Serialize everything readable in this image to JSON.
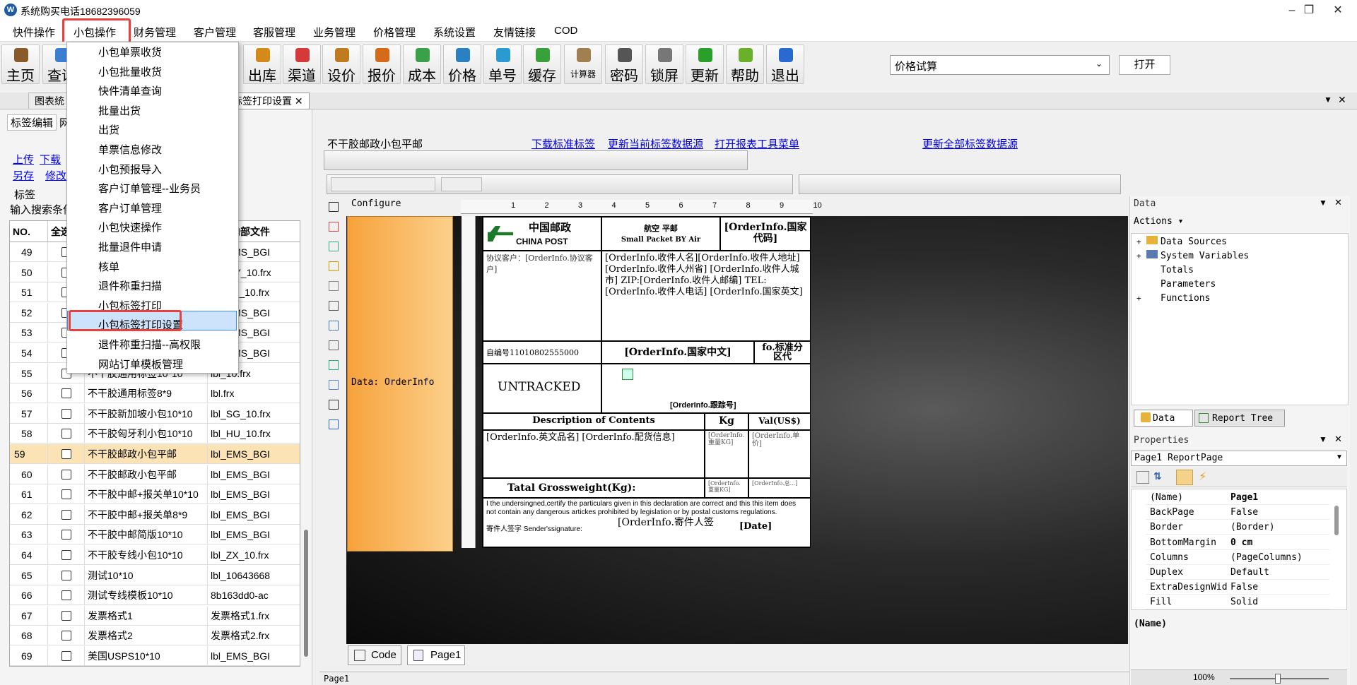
{
  "window": {
    "title": "系统购买电话18682396059",
    "icon": "app-logo-icon"
  },
  "menubar": [
    "快件操作",
    "小包操作",
    "财务管理",
    "客户管理",
    "客服管理",
    "业务管理",
    "价格管理",
    "系统设置",
    "友情链接",
    "COD"
  ],
  "toolbar": {
    "buttons": [
      {
        "label": "主页",
        "icon": "home-icon",
        "color": "#8a5a2b"
      },
      {
        "label": "查询",
        "icon": "search-icon",
        "color": "#3a7fd0"
      },
      {
        "label": "出库",
        "icon": "outbound-icon",
        "color": "#d48a1a"
      },
      {
        "label": "渠道",
        "icon": "channel-icon",
        "color": "#d43a3a"
      },
      {
        "label": "设价",
        "icon": "scale-icon",
        "color": "#c07a20"
      },
      {
        "label": "报价",
        "icon": "quote-icon",
        "color": "#d46a1a"
      },
      {
        "label": "成本",
        "icon": "chart-icon",
        "color": "#3aa04a"
      },
      {
        "label": "价格",
        "icon": "price-icon",
        "color": "#2a80c0"
      },
      {
        "label": "单号",
        "icon": "eye-icon",
        "color": "#2a9ad0"
      },
      {
        "label": "缓存",
        "icon": "refresh-icon",
        "color": "#3aa03a"
      },
      {
        "label": "计算器",
        "icon": "calculator-icon",
        "color": "#a08050"
      },
      {
        "label": "密码",
        "icon": "key-icon",
        "color": "#555"
      },
      {
        "label": "锁屏",
        "icon": "lock-icon",
        "color": "#777"
      },
      {
        "label": "更新",
        "icon": "download-icon",
        "color": "#2aa02a"
      },
      {
        "label": "帮助",
        "icon": "help-icon",
        "color": "#6ab02a"
      },
      {
        "label": "退出",
        "icon": "power-icon",
        "color": "#2a6ad0"
      }
    ],
    "combo_value": "价格试算",
    "open_label": "打开"
  },
  "tabs": [
    "图表统",
    "标签打印设置"
  ],
  "left": {
    "subtabs": [
      "标签编辑",
      "网"
    ],
    "links": [
      "上传",
      "下载",
      "另存",
      "修改"
    ],
    "group_label": "标签",
    "search_label": "输入搜索条件",
    "columns": [
      "NO.",
      "全选",
      "",
      "标签内部文件"
    ],
    "rows": [
      {
        "no": "49",
        "name": "",
        "file": "lbl_EMS_BGI"
      },
      {
        "no": "50",
        "name": "",
        "file": "lbl_MY_10.frx"
      },
      {
        "no": "51",
        "name": "",
        "file": "lbl_SE_10.frx"
      },
      {
        "no": "52",
        "name": "",
        "file": "lbl_EMS_BGI"
      },
      {
        "no": "53",
        "name": "",
        "file": "lbl_EMS_BGI"
      },
      {
        "no": "54",
        "name": "",
        "file": "lbl_EMS_BGI"
      },
      {
        "no": "55",
        "name": "不干胶通用标签10*10",
        "file": "lbl_10.frx"
      },
      {
        "no": "56",
        "name": "不干胶通用标签8*9",
        "file": "lbl.frx"
      },
      {
        "no": "57",
        "name": "不干胶新加坡小包10*10",
        "file": "lbl_SG_10.frx"
      },
      {
        "no": "58",
        "name": "不干胶匈牙利小包10*10",
        "file": "lbl_HU_10.frx"
      },
      {
        "no": "59",
        "name": "不干胶邮政小包平邮",
        "file": "lbl_EMS_BGI"
      },
      {
        "no": "60",
        "name": "不干胶邮政小包平邮",
        "file": "lbl_EMS_BGI"
      },
      {
        "no": "61",
        "name": "不干胶中邮+报关单10*10",
        "file": "lbl_EMS_BGI"
      },
      {
        "no": "62",
        "name": "不干胶中邮+报关单8*9",
        "file": "lbl_EMS_BGI"
      },
      {
        "no": "63",
        "name": "不干胶中邮简版10*10",
        "file": "lbl_EMS_BGI"
      },
      {
        "no": "64",
        "name": "不干胶专线小包10*10",
        "file": "lbl_ZX_10.frx"
      },
      {
        "no": "65",
        "name": "测试10*10",
        "file": "lbl_10643668"
      },
      {
        "no": "66",
        "name": "测试专线模板10*10",
        "file": "8b163dd0-ac"
      },
      {
        "no": "67",
        "name": "发票格式1",
        "file": "发票格式1.frx"
      },
      {
        "no": "68",
        "name": "发票格式2",
        "file": "发票格式2.frx"
      },
      {
        "no": "69",
        "name": "美国USPS10*10",
        "file": "lbl_EMS_BGI"
      }
    ],
    "selected_row": "59"
  },
  "dropdown": [
    "小包单票收货",
    "小包批量收货",
    "快件清单查询",
    "批量出货",
    "出货",
    "单票信息修改",
    "小包预报导入",
    "客户订单管理--业务员",
    "客户订单管理",
    "小包快速操作",
    "批量退件申请",
    "核单",
    "退件称重扫描",
    "小包标签打印",
    "小包标签打印设置",
    "退件称重扫描--高权限",
    "网站订单模板管理"
  ],
  "dropdown_selected": "小包标签打印设置",
  "designer": {
    "report_name": "不干胶邮政小包平邮",
    "links": [
      "下载标准标签",
      "更新当前标签数据源",
      "打开报表工具菜单",
      "更新全部标签数据源"
    ],
    "band_title": "Configure",
    "band_data": "Data: OrderInfo",
    "ruler": [
      "1",
      "2",
      "3",
      "4",
      "5",
      "6",
      "7",
      "8",
      "9",
      "10"
    ],
    "label": {
      "logo_cn": "中国邮政",
      "logo_en": "CHINA POST",
      "air_cn": "航空 平邮",
      "air_en": "Small Packet BY Air",
      "country_code": "[OrderInfo.国家代码]",
      "customer": "协议客户：[OrderInfo.协议客户]",
      "receiver": "[OrderInfo.收件人名][OrderInfo.收件人地址][OrderInfo.收件人州省] [OrderInfo.收件人城市] ZIP:[OrderInfo.收件人邮编] TEL:[OrderInfo.收件人电话] [OrderInfo.国家英文]",
      "pickup": "自编号11010802555000",
      "country_cn": "[OrderInfo.国家中文]",
      "zone": "fo.标准分区代",
      "untracked": "UNTRACKED",
      "tracking": "[OrderInfo.跟踪号]",
      "desc_header": "Description of Contents",
      "kg_header": "Kg",
      "val_header": "Val(US$)",
      "desc_value": "[OrderInfo.英文品名] [OrderInfo.配货信息]",
      "kg_value": "[OrderInfo.重量KG]",
      "val_value": "[OrderInfo.单价]",
      "total_label": "Tatal Grossweight(Kg):",
      "total_kg": "[OrderInfo.重量KG]",
      "total_val": "[OrderInfo.总...]",
      "declaration": "I the undersingned,certify the particulars given in this declaration are correct and this this item does not contain any dangerous artickes prohibited by legislation or by postal customs regulations.",
      "sender_label": "寄件人签字 Sender'ssignature:",
      "sender_value": "[OrderInfo.寄件人签",
      "date": "[Date]"
    },
    "bottom_tabs": [
      "Code",
      "Page1"
    ],
    "status": "Page1"
  },
  "data_panel": {
    "title": "Data",
    "actions": "Actions",
    "tree": [
      "Data Sources",
      "System Variables",
      "Totals",
      "Parameters",
      "Functions"
    ],
    "tabs": [
      "Data",
      "Report Tree"
    ]
  },
  "properties": {
    "title": "Properties",
    "object": "Page1 ReportPage",
    "rows": [
      [
        "(Name)",
        "Page1"
      ],
      [
        "BackPage",
        "False"
      ],
      [
        "Border",
        "(Border)"
      ],
      [
        "BottomMargin",
        "0 cm"
      ],
      [
        "Columns",
        "(PageColumns)"
      ],
      [
        "Duplex",
        "Default"
      ],
      [
        "ExtraDesignWid",
        "False"
      ],
      [
        "Fill",
        "Solid"
      ]
    ],
    "description": "(Name)",
    "zoom": "100%"
  }
}
